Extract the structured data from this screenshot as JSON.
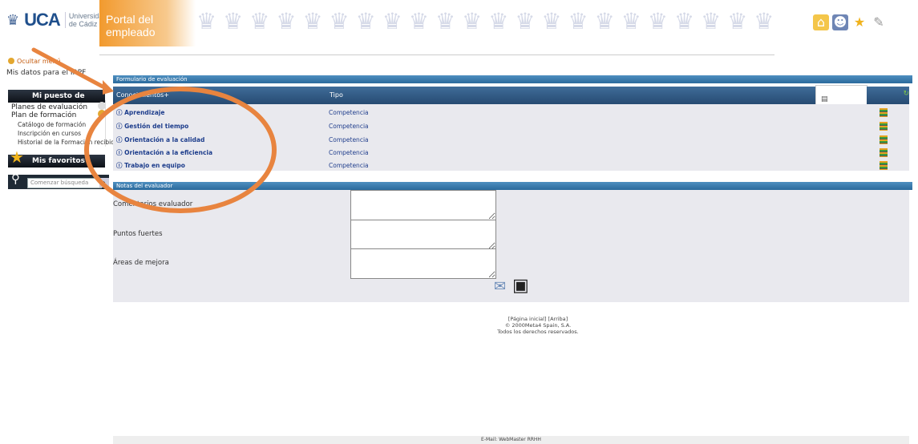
{
  "header": {
    "logo_text": "UCA",
    "logo_sub": "Universidad de Cádiz",
    "portal_title": "Portal del empleado",
    "icons": [
      "home-icon",
      "users-icon",
      "favorites-star-icon",
      "tools-icon"
    ]
  },
  "sidebar": {
    "hide_menu": "Ocultar menú",
    "irpf": "Mis datos para el IRPF",
    "section1_title": "Mi puesto de trabajo",
    "items": [
      "Planes de evaluación",
      "Plan de formación"
    ],
    "subitems": [
      "Catálogo de formación",
      "Inscripción en cursos",
      "Historial de la Formación recibida"
    ],
    "section2_title": "Mis favoritos",
    "search_placeholder": "Comenzar búsqueda"
  },
  "form": {
    "title": "Formulario de evaluación",
    "columns": [
      "Conocimientos+",
      "Tipo"
    ],
    "rows": [
      {
        "name": "Aprendizaje",
        "type": "Competencia"
      },
      {
        "name": "Gestión del tiempo",
        "type": "Competencia"
      },
      {
        "name": "Orientación a la calidad",
        "type": "Competencia"
      },
      {
        "name": "Orientación a la eficiencia",
        "type": "Competencia"
      },
      {
        "name": "Trabajo en equipo",
        "type": "Competencia"
      }
    ],
    "notes_title": "Notas del evaluador",
    "note_fields": [
      "Comentarios evaluador",
      "Puntos fuertes",
      "Áreas de mejora"
    ]
  },
  "footer": {
    "links": "[Página inicial] [Arriba]",
    "copyright": "© 2000Meta4 Spain, S.A.",
    "rights": "Todos los derechos reservados.",
    "email": "E-Mail: WebMaster RRHH"
  },
  "colors": {
    "accent": "#e8843f",
    "header_blue": "#2b6a9c"
  }
}
